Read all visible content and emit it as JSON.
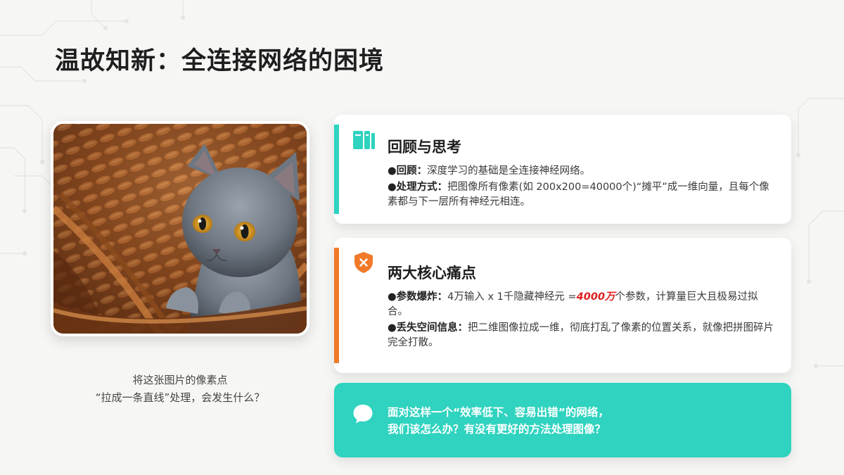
{
  "title": "温故知新：全连接网络的困境",
  "image": {
    "alt_icon": "kitten-in-basket-photo"
  },
  "caption": {
    "line1": "将这张图片的像素点",
    "line2": "“拉成一条直线”处理，会发生什么？"
  },
  "review_card": {
    "icon": "book-icon",
    "heading": "回顾与思考",
    "point1_label": "●回顾：",
    "point1_text": "深度学习的基础是全连接神经网络。",
    "point2_label": "●处理方式：",
    "point2_text": "把图像所有像素(如 200x200=40000个)“摊平”成一维向量，且每个像素都与下一层所有神经元相连。"
  },
  "pain_card": {
    "icon": "shield-x-icon",
    "heading": "两大核心痛点",
    "point1_label": "●参数爆炸：",
    "point1_pre": "4万输入 x 1千隐藏神经元 =",
    "point1_highlight": "4000万",
    "point1_post": "个参数，计算量巨大且极易过拟合。",
    "point2_label": "●丢失空间信息：",
    "point2_text": "把二维图像拉成一维，彻底打乱了像素的位置关系，就像把拼图碎片完全打散。"
  },
  "question_card": {
    "icon": "chat-bubble-icon",
    "line1": "面对这样一个“效率低下、容易出错”的网络，",
    "line2": "我们该怎么办？有没有更好的方法处理图像？"
  },
  "colors": {
    "accent_teal": "#2fd3bf",
    "accent_orange": "#f07a2a",
    "highlight_red": "#e02020"
  }
}
